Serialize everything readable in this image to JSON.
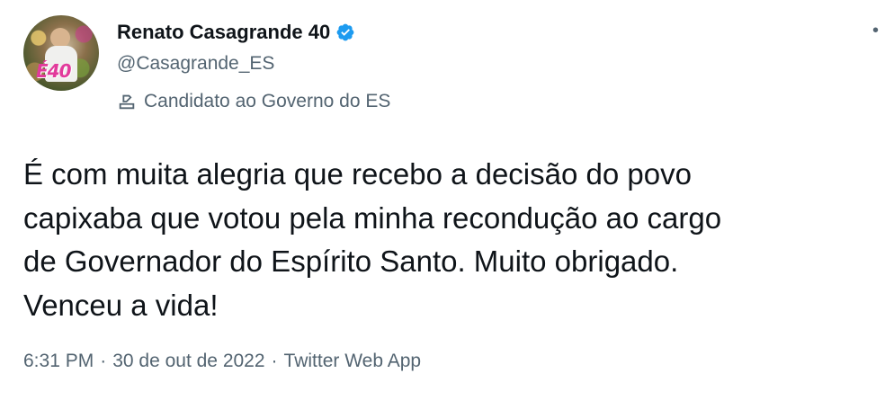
{
  "author": {
    "display_name": "Renato Casagrande 40",
    "handle": "@Casagrande_ES",
    "label": "Candidato ao Governo do ES",
    "avatar_badge": "É40"
  },
  "icons": {
    "verified": "verified-badge-icon",
    "label": "ballot-box-icon",
    "more": "more-options-icon"
  },
  "colors": {
    "verified_blue": "#1d9bf0",
    "text_primary": "#0f1419",
    "text_secondary": "#536471"
  },
  "tweet": {
    "text": "É com muita alegria que recebo a decisão do povo\ncapixaba que votou pela minha recondução ao cargo\nde Governador do Espírito Santo. Muito obrigado.\nVenceu a vida!",
    "time": "6:31 PM",
    "separator": "·",
    "date": "30 de out de 2022",
    "source": "Twitter Web App"
  }
}
